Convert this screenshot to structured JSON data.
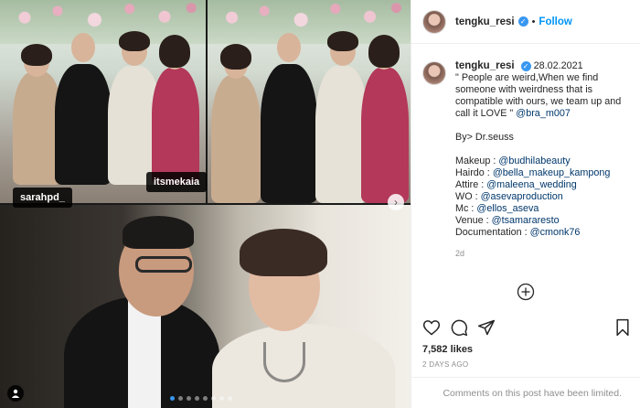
{
  "post": {
    "username": "tengku_resi",
    "follow_label": "Follow",
    "separator": "•",
    "caption_date": "28.02.2021",
    "caption_lines": [
      "\" People are weird,When we find",
      "someone with weirdness that is",
      "compatible with ours, we team up and",
      "call it LOVE \" "
    ],
    "caption_mention_love": "@bra_m007",
    "by_line": "By> Dr.seuss",
    "credits": [
      {
        "label": "Makeup : ",
        "handle": "@budhilabeauty"
      },
      {
        "label": "Hairdo : ",
        "handle": "@bella_makeup_kampong"
      },
      {
        "label": "Attire : ",
        "handle": "@maleena_wedding"
      },
      {
        "label": "WO : ",
        "handle": "@asevaproduction"
      },
      {
        "label": "Mc : ",
        "handle": "@ellos_aseva"
      },
      {
        "label": "Venue : ",
        "handle": "@tsamararesto"
      },
      {
        "label": "Documentation : ",
        "handle": "@cmonk76"
      }
    ],
    "age": "2d",
    "likes": "7,582 likes",
    "ago": "2 DAYS AGO",
    "comments_notice": "Comments on this post have been limited."
  },
  "photo_tags": {
    "left": "sarahpd_",
    "right": "itsmekaia"
  },
  "icons": {
    "verified": "verified-badge-icon",
    "like": "heart-icon",
    "comment": "comment-bubble-icon",
    "share": "paper-plane-icon",
    "save": "bookmark-icon",
    "add": "plus-circle-icon",
    "next": "chevron-right-icon",
    "user_tag": "user-icon"
  },
  "colors": {
    "accent": "#0095f6",
    "verified": "#3897f0",
    "mention": "#00376b",
    "muted": "#8e8e8e"
  }
}
